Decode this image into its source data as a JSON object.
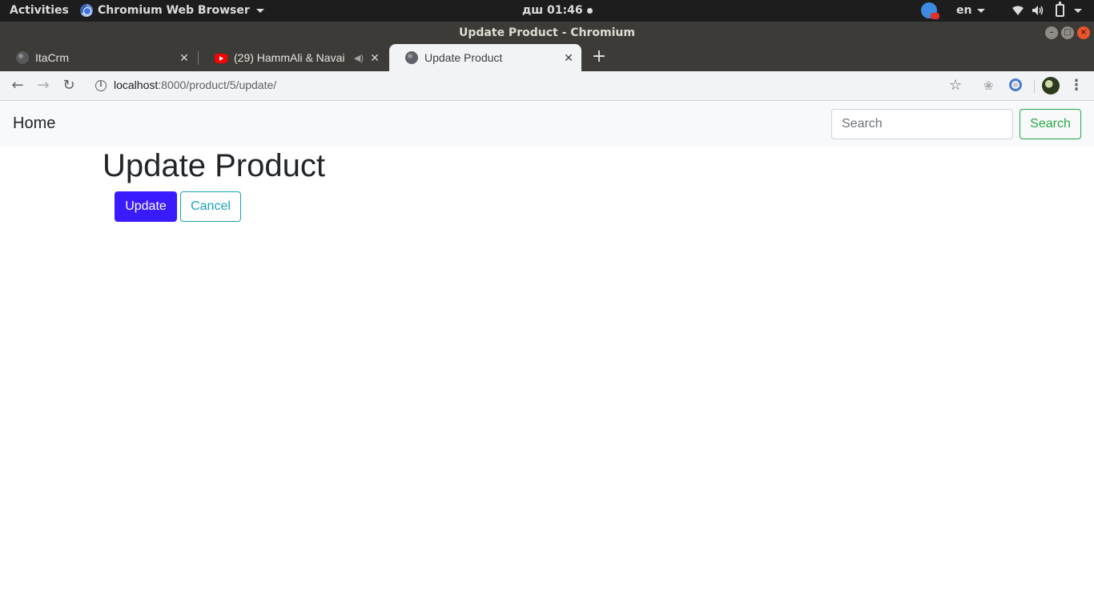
{
  "system_bar": {
    "activities": "Activities",
    "app_name": "Chromium Web Browser",
    "clock": "дш 01:46",
    "language": "en"
  },
  "window": {
    "title": "Update Product - Chromium"
  },
  "tabs": [
    {
      "label": "ItaCrm",
      "favicon": "globe-icon",
      "active": false
    },
    {
      "label": "(29) HammAli & Navai",
      "favicon": "youtube-icon",
      "active": false,
      "audio": true
    },
    {
      "label": "Update Product",
      "favicon": "globe-icon",
      "active": true
    }
  ],
  "address_bar": {
    "host": "localhost",
    "path": ":8000/product/5/update/"
  },
  "navbar": {
    "brand": "Home",
    "search_placeholder": "Search",
    "search_button": "Search"
  },
  "main": {
    "title": "Update Product",
    "update_button": "Update",
    "cancel_button": "Cancel"
  },
  "colors": {
    "update_button": "#3a1aff",
    "cancel_button": "#17a2b8",
    "search_button": "#28a745"
  }
}
